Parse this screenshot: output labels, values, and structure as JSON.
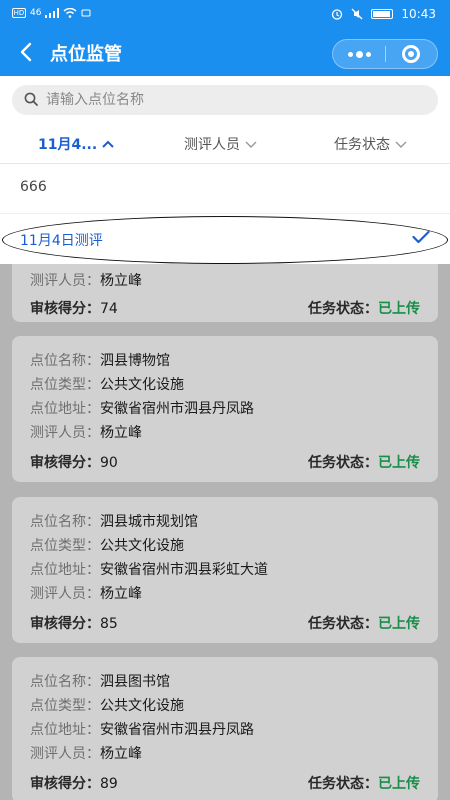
{
  "status_bar": {
    "left": "46",
    "time": "10:43"
  },
  "header": {
    "title": "点位监管"
  },
  "search": {
    "placeholder": "请输入点位名称"
  },
  "filters": {
    "date": "11月4...",
    "person": "测评人员",
    "status": "任务状态"
  },
  "dropdown": {
    "options": [
      {
        "label": "666",
        "selected": false
      },
      {
        "label": "11月4日测评",
        "selected": true
      }
    ]
  },
  "cards": [
    {
      "person_label": "测评人员：",
      "person": "杨立峰",
      "score_label": "审核得分：",
      "score": "74",
      "status_label": "任务状态：",
      "status": "已上传"
    },
    {
      "name_label": "点位名称：",
      "name": "泗县博物馆",
      "type_label": "点位类型：",
      "type": "公共文化设施",
      "addr_label": "点位地址：",
      "addr": "安徽省宿州市泗县丹凤路",
      "person_label": "测评人员：",
      "person": "杨立峰",
      "score_label": "审核得分：",
      "score": "90",
      "status_label": "任务状态：",
      "status": "已上传"
    },
    {
      "name_label": "点位名称：",
      "name": "泗县城市规划馆",
      "type_label": "点位类型：",
      "type": "公共文化设施",
      "addr_label": "点位地址：",
      "addr": "安徽省宿州市泗县彩虹大道",
      "person_label": "测评人员：",
      "person": "杨立峰",
      "score_label": "审核得分：",
      "score": "85",
      "status_label": "任务状态：",
      "status": "已上传"
    },
    {
      "name_label": "点位名称：",
      "name": "泗县图书馆",
      "type_label": "点位类型：",
      "type": "公共文化设施",
      "addr_label": "点位地址：",
      "addr": "安徽省宿州市泗县丹凤路",
      "person_label": "测评人员：",
      "person": "杨立峰",
      "score_label": "审核得分：",
      "score": "89",
      "status_label": "任务状态：",
      "status": "已上传"
    }
  ],
  "colors": {
    "primary": "#1b8ff0",
    "active_text": "#1a5fd0",
    "status_green": "#1fae5a"
  }
}
